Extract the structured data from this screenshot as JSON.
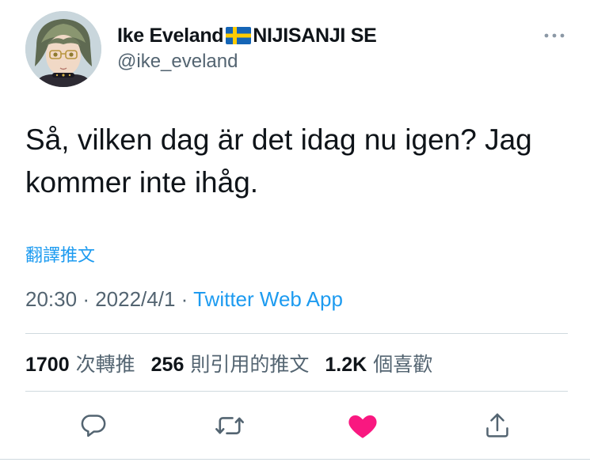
{
  "author": {
    "display_name": "Ike Eveland",
    "flag_emoji": "🇸🇪",
    "name_suffix": "NIJISANJI SE",
    "handle": "@ike_eveland",
    "avatar_icon": "avatar-illustration"
  },
  "tweet": {
    "text": "Så, vilken dag är det idag nu igen? Jag kommer inte ihåg.",
    "translate_label": "翻譯推文",
    "time": "20:30",
    "date": "2022/4/1",
    "separator": "·",
    "source": "Twitter Web App"
  },
  "stats": {
    "retweets_count": "1700",
    "retweets_label": "次轉推",
    "quotes_count": "256",
    "quotes_label": "則引用的推文",
    "likes_count": "1.2K",
    "likes_label": "個喜歡"
  },
  "actions": {
    "reply_icon": "reply-icon",
    "retweet_icon": "retweet-icon",
    "like_icon": "heart-icon",
    "share_icon": "share-icon",
    "like_color": "#f91880"
  },
  "colors": {
    "accent": "#1d9bf0",
    "secondary_text": "#536471",
    "primary_text": "#0f1419",
    "divider": "#cfd9de"
  }
}
